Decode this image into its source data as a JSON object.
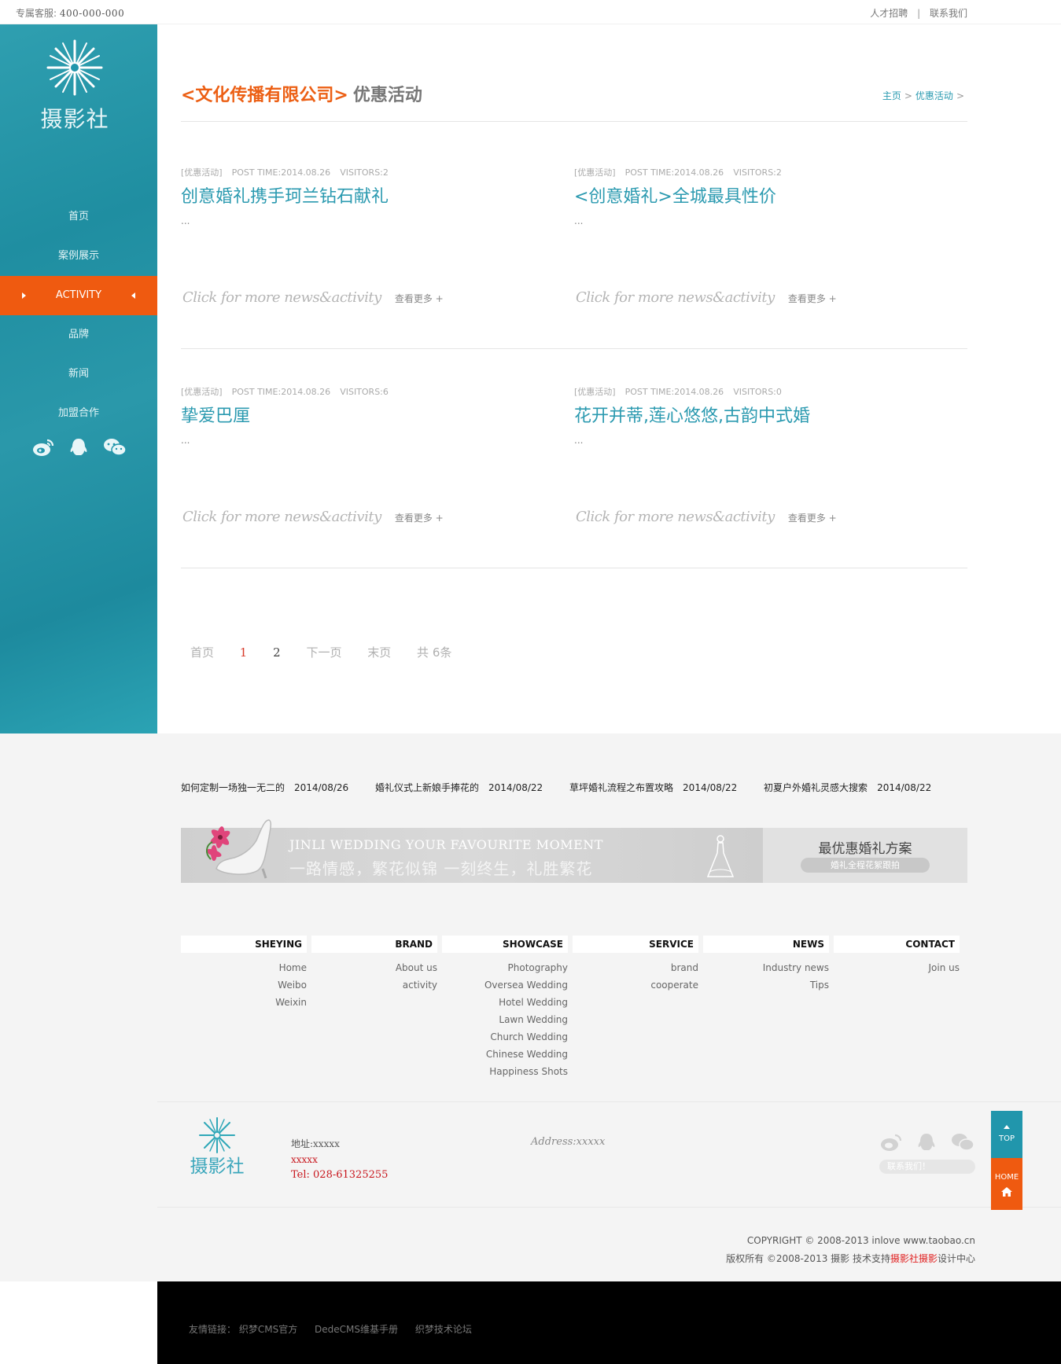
{
  "topbar": {
    "hotline_label": "专属客服:",
    "hotline_number": "400-000-000",
    "link_recruit": "人才招聘",
    "link_separator": "|",
    "link_contact": "联系我们"
  },
  "sidebar": {
    "logo_text": "摄影社",
    "nav": [
      {
        "label": "首页"
      },
      {
        "label": "案例展示"
      },
      {
        "label": "ACTIVITY"
      },
      {
        "label": "品牌"
      },
      {
        "label": "新闻"
      },
      {
        "label": "加盟合作"
      }
    ],
    "social_icons": [
      "weibo-icon",
      "qq-icon",
      "wechat-icon"
    ]
  },
  "header": {
    "company": "<文化传播有限公司>",
    "section": "优惠活动",
    "breadcrumb": [
      "主页",
      "优惠活动"
    ],
    "breadcrumb_sep": ">"
  },
  "posts": [
    {
      "category": "[优惠活动]",
      "time": "POST TIME:2014.08.26",
      "visitors": "VISITORS:2",
      "title": "创意婚礼携手珂兰钻石献礼",
      "excerpt": "...",
      "more_script": "Click for more news&activity",
      "more_link": "查看更多 +"
    },
    {
      "category": "[优惠活动]",
      "time": "POST TIME:2014.08.26",
      "visitors": "VISITORS:2",
      "title": "<创意婚礼>全城最具性价",
      "excerpt": "...",
      "more_script": "Click for more news&activity",
      "more_link": "查看更多 +"
    },
    {
      "category": "[优惠活动]",
      "time": "POST TIME:2014.08.26",
      "visitors": "VISITORS:6",
      "title": "挚爱巴厘",
      "excerpt": "...",
      "more_script": "Click for more news&activity",
      "more_link": "查看更多 +"
    },
    {
      "category": "[优惠活动]",
      "time": "POST TIME:2014.08.26",
      "visitors": "VISITORS:0",
      "title": "花开并蒂,莲心悠悠,古韵中式婚",
      "excerpt": "...",
      "more_script": "Click for more news&activity",
      "more_link": "查看更多 +"
    }
  ],
  "pager": {
    "first": "首页",
    "page1": "1",
    "page2": "2",
    "next": "下一页",
    "last": "末页",
    "total": "共 6条"
  },
  "footer_news": [
    {
      "title": "如何定制一场独一无二的",
      "date": "2014/08/26"
    },
    {
      "title": "婚礼仪式上新娘手捧花的",
      "date": "2014/08/22"
    },
    {
      "title": "草坪婚礼流程之布置攻略",
      "date": "2014/08/22"
    },
    {
      "title": "初夏户外婚礼灵感大搜索",
      "date": "2014/08/22"
    }
  ],
  "banner": {
    "en": "JINLI WEDDING   YOUR  FAVOURITE MOMENT",
    "cn": "一路情感，繁花似锦    一刻终生，礼胜繁花",
    "right_title": "最优惠婚礼方案",
    "right_pill": "婚礼全程花絮跟拍"
  },
  "footer_columns": [
    {
      "heading": "SHEYING",
      "links": [
        "Home",
        "Weibo",
        "Weixin"
      ]
    },
    {
      "heading": "BRAND",
      "links": [
        "About us",
        "activity"
      ]
    },
    {
      "heading": "SHOWCASE",
      "links": [
        "Photography",
        "Oversea Wedding",
        "Hotel Wedding",
        "Lawn Wedding",
        "Church Wedding",
        "Chinese Wedding",
        "Happiness Shots"
      ]
    },
    {
      "heading": "SERVICE",
      "links": [
        "brand",
        "cooperate"
      ]
    },
    {
      "heading": "NEWS",
      "links": [
        "Industry news",
        "Tips"
      ]
    },
    {
      "heading": "CONTACT",
      "links": [
        "Join us"
      ]
    }
  ],
  "contact": {
    "logo_text": "摄影社",
    "address": "地址:xxxxx",
    "line2": "xxxxx",
    "tel": "Tel: 028-61325255",
    "address_en": "Address:xxxxx",
    "contact_pill": "联系我们！"
  },
  "copyright": {
    "line1": "COPYRIGHT © 2008-2013 inlove www.taobao.cn",
    "line2_pre": "版权所有 ©2008-2013 摄影   技术支持",
    "line2_red": "摄影社摄影",
    "line2_post": "设计中心"
  },
  "float": {
    "top": "TOP",
    "home": "HOME"
  },
  "friend_links": {
    "label": "友情链接：",
    "items": [
      "织梦CMS官方",
      "DedeCMS维基手册",
      "织梦技术论坛"
    ]
  },
  "colors": {
    "teal": "#2196ac",
    "orange": "#ef5a10",
    "title_blue": "#2b9ab0"
  }
}
